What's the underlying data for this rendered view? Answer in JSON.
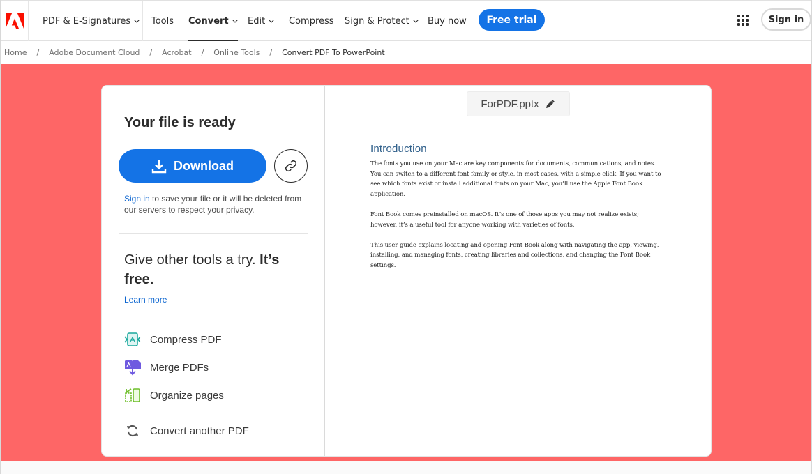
{
  "nav": {
    "logo": "adobe-logo",
    "items": [
      {
        "label": "PDF & E-Signatures",
        "dropdown": true
      },
      {
        "label": "Tools",
        "dropdown": false
      },
      {
        "label": "Convert",
        "dropdown": true,
        "active": true
      },
      {
        "label": "Edit",
        "dropdown": true
      },
      {
        "label": "Compress",
        "dropdown": false
      },
      {
        "label": "Sign & Protect",
        "dropdown": true
      },
      {
        "label": "Buy now",
        "dropdown": false
      }
    ],
    "free_trial_label": "Free trial",
    "apps_icon": "apps-grid-icon",
    "sign_in_label": "Sign in"
  },
  "breadcrumb": {
    "items": [
      "Home",
      "Adobe Document Cloud",
      "Acrobat",
      "Online Tools"
    ],
    "current": "Convert PDF To PowerPoint",
    "separator": "/"
  },
  "colors": {
    "accent": "#1473e6",
    "stage_bg": "#fe6666",
    "link": "#0d66d0"
  },
  "result": {
    "title": "Your file is ready",
    "download_label": "Download",
    "link_icon": "link-icon",
    "save_note_link": "Sign in",
    "save_note_text": " to save your file or it will be deleted from our servers to respect your privacy."
  },
  "promo": {
    "title_regular": "Give other tools a try. ",
    "title_bold": "It’s free.",
    "learn_more": "Learn more",
    "tools": [
      {
        "label": "Compress PDF",
        "icon": "compress-pdf-icon"
      },
      {
        "label": "Merge PDFs",
        "icon": "merge-pdfs-icon"
      },
      {
        "label": "Organize pages",
        "icon": "organize-pages-icon"
      }
    ],
    "convert_another": "Convert another PDF"
  },
  "preview": {
    "filename": "ForPDF.pptx",
    "heading": "Introduction",
    "paragraphs": [
      "The fonts you use on your Mac are key components for documents, communications, and notes. You can switch to a different font family or style, in most cases, with a simple click.  If you want to see which fonts exist or install  additional fonts on your Mac, you’ll use the Apple Font Book application.",
      "Font Book comes preinstalled on macOS. It’s one of those apps you may not realize exists; however, it’s a useful tool for anyone working with varieties of fonts.",
      "This user guide explains locating and opening Font Book  along with navigating the app, viewing, installing,  and managing fonts, creating libraries and collections, and changing the Font Book settings."
    ]
  }
}
